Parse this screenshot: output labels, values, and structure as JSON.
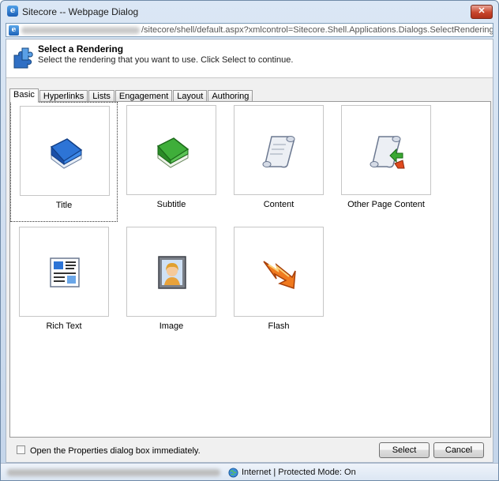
{
  "window": {
    "title": "Sitecore -- Webpage Dialog",
    "close_label": "✕",
    "url_text": "/sitecore/shell/default.aspx?xmlcontrol=Sitecore.Shell.Applications.Dialogs.SelectRendering&hd"
  },
  "header": {
    "title": "Select a Rendering",
    "description": "Select the rendering that you want to use. Click Select to continue."
  },
  "tabs": [
    {
      "label": "Basic"
    },
    {
      "label": "Hyperlinks"
    },
    {
      "label": "Lists"
    },
    {
      "label": "Engagement"
    },
    {
      "label": "Layout"
    },
    {
      "label": "Authoring"
    }
  ],
  "renderings": [
    {
      "label": "Title",
      "icon": "blue-book-icon"
    },
    {
      "label": "Subtitle",
      "icon": "green-book-icon"
    },
    {
      "label": "Content",
      "icon": "scroll-icon"
    },
    {
      "label": "Other Page Content",
      "icon": "scroll-arrow-icon"
    },
    {
      "label": "Rich Text",
      "icon": "rich-text-document-icon"
    },
    {
      "label": "Image",
      "icon": "portrait-icon"
    },
    {
      "label": "Flash",
      "icon": "lightning-bolt-icon"
    }
  ],
  "footer": {
    "checkbox_label": "Open the Properties dialog box immediately.",
    "select_label": "Select",
    "cancel_label": "Cancel"
  },
  "status": {
    "zone_text": "Internet | Protected Mode: On"
  },
  "colors": {
    "titlebar": "#c4d5ea",
    "close_button": "#c8462c",
    "panel_background": "#ffffff",
    "dialog_background": "#f0f0f0"
  }
}
